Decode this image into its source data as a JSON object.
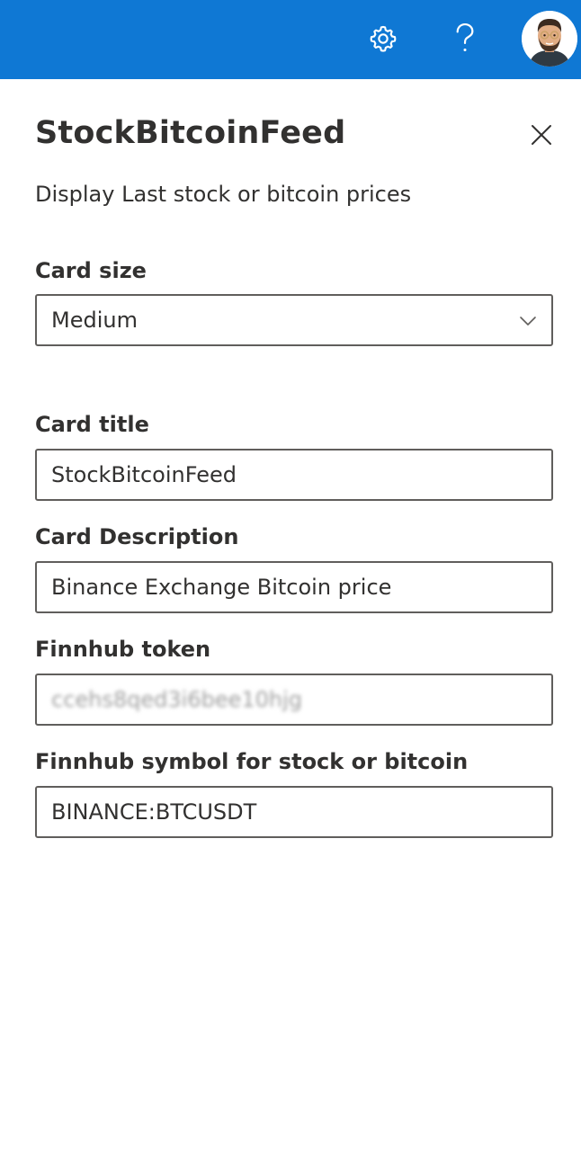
{
  "header": {
    "settings_icon": "gear-icon",
    "help_icon": "question-icon",
    "avatar_icon": "user-avatar"
  },
  "panel": {
    "title": "StockBitcoinFeed",
    "description": "Display Last stock or bitcoin prices",
    "close_icon": "close-icon"
  },
  "fields": {
    "card_size": {
      "label": "Card size",
      "value": "Medium"
    },
    "card_title": {
      "label": "Card title",
      "value": "StockBitcoinFeed"
    },
    "card_description": {
      "label": "Card Description",
      "value": "Binance Exchange Bitcoin price"
    },
    "finnhub_token": {
      "label": "Finnhub token",
      "value": "ccehs8qed3i6bee10hjg"
    },
    "finnhub_symbol": {
      "label": "Finnhub symbol for stock or bitcoin",
      "value": "BINANCE:BTCUSDT"
    }
  },
  "colors": {
    "header_bg": "#0f78d4",
    "text": "#323130",
    "border": "#605e5c"
  }
}
